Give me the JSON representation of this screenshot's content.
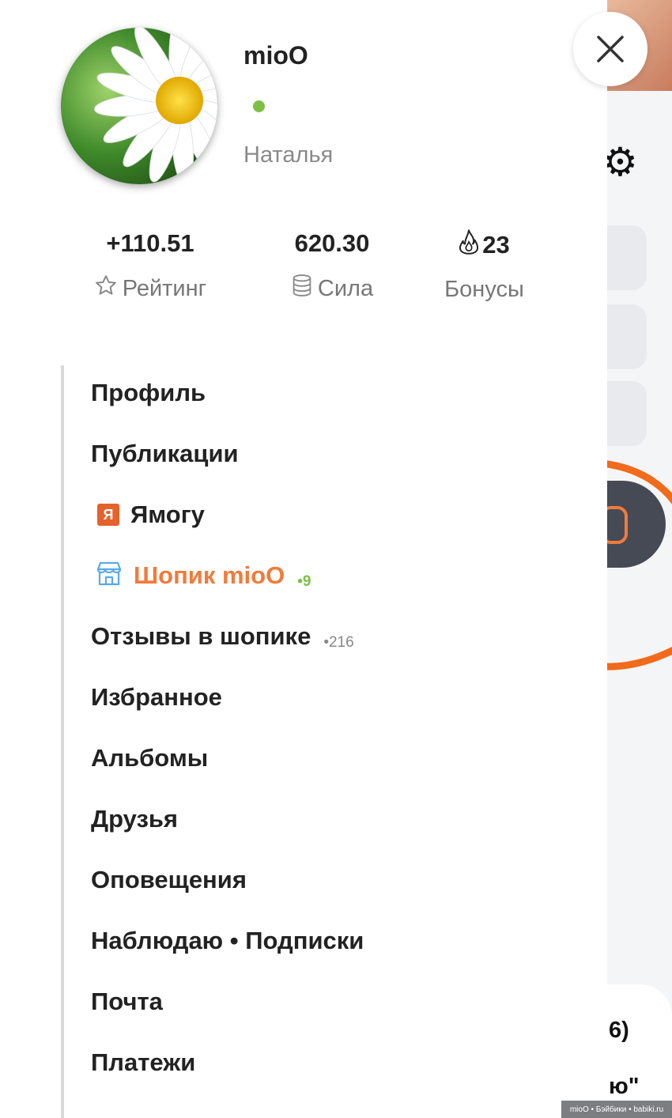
{
  "profile": {
    "username": "mioO",
    "real_name": "Наталья",
    "online_status_color": "#7cc143"
  },
  "stats": [
    {
      "value": "+110.51",
      "label": "Рейтинг",
      "icon": "star-icon"
    },
    {
      "value": "620.30",
      "label": "Сила",
      "icon": "database-icon"
    },
    {
      "value": "23",
      "label": "Бонусы",
      "icon": "flame-icon"
    }
  ],
  "menu": {
    "items": [
      {
        "label": "Профиль"
      },
      {
        "label": "Публикации"
      },
      {
        "label": "Ямогу",
        "badge": "Я",
        "badge_color": "#e5622d"
      },
      {
        "label": "Шопик mioO",
        "count": "•9",
        "icon": "shop-icon",
        "label_color": "#f07b3b",
        "count_color": "#7cc143"
      },
      {
        "label": "Отзывы в шопике",
        "count": "•216"
      },
      {
        "label": "Избранное"
      },
      {
        "label": "Альбомы"
      },
      {
        "label": "Друзья"
      },
      {
        "label": "Оповещения"
      },
      {
        "label": "Наблюдаю • Подписки"
      },
      {
        "label": "Почта"
      },
      {
        "label": "Платежи"
      }
    ]
  },
  "background": {
    "visible_right_text_1": "6)",
    "visible_right_text_2": "ю\""
  },
  "watermark": "mioO • Бэйбики • babiki.ru",
  "colors": {
    "accent_orange": "#f07b3b",
    "online_green": "#7cc143",
    "dark_pill": "#464a55"
  }
}
